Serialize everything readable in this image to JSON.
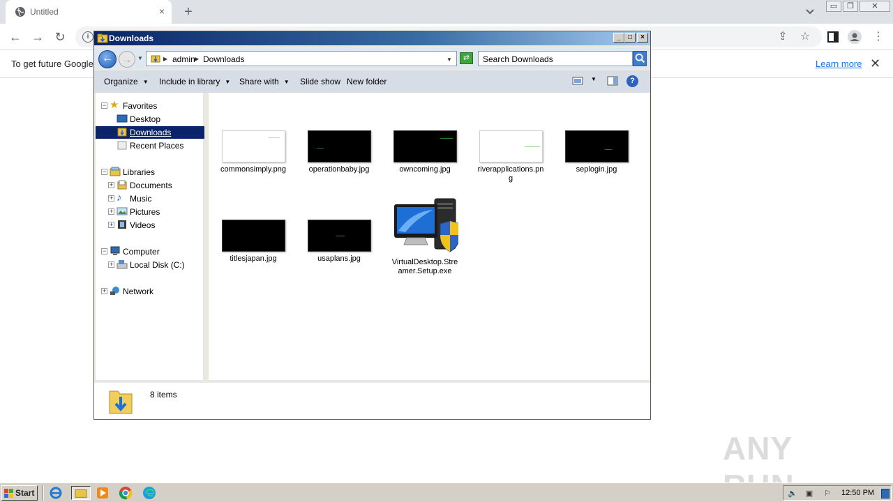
{
  "browser": {
    "tab_title": "Untitled",
    "tab_close": "×",
    "new_tab": "+",
    "infobar_message": "To get future Google",
    "infobar_link": "Learn more",
    "infobar_close": "✕"
  },
  "explorer": {
    "window_title": "Downloads",
    "breadcrumb": [
      "admin",
      "Downloads"
    ],
    "search_placeholder": "Search Downloads",
    "commands": {
      "organize": "Organize",
      "include_in_library": "Include in library",
      "share_with": "Share with",
      "slide_show": "Slide show",
      "new_folder": "New folder"
    },
    "help": "?",
    "nav": {
      "favorites": "Favorites",
      "desktop": "Desktop",
      "downloads": "Downloads",
      "recent_places": "Recent Places",
      "libraries": "Libraries",
      "documents": "Documents",
      "music": "Music",
      "pictures": "Pictures",
      "videos": "Videos",
      "computer": "Computer",
      "local_disk": "Local Disk (C:)",
      "network": "Network"
    },
    "files": [
      {
        "name": "commonsimply.png",
        "thumb": "light"
      },
      {
        "name": "operationbaby.jpg",
        "thumb": "dark"
      },
      {
        "name": "owncoming.jpg",
        "thumb": "dark"
      },
      {
        "name": "riverapplications.png",
        "thumb": "light"
      },
      {
        "name": "seplogin.jpg",
        "thumb": "dark"
      },
      {
        "name": "titlesjapan.jpg",
        "thumb": "dark"
      },
      {
        "name": "usaplans.jpg",
        "thumb": "dark"
      },
      {
        "name": "VirtualDesktop.Streamer.Setup.exe",
        "thumb": "exe"
      }
    ],
    "status": "8 items"
  },
  "watermark": "ANY RUN",
  "taskbar": {
    "start_label": "Start",
    "clock": "12:50 PM"
  }
}
